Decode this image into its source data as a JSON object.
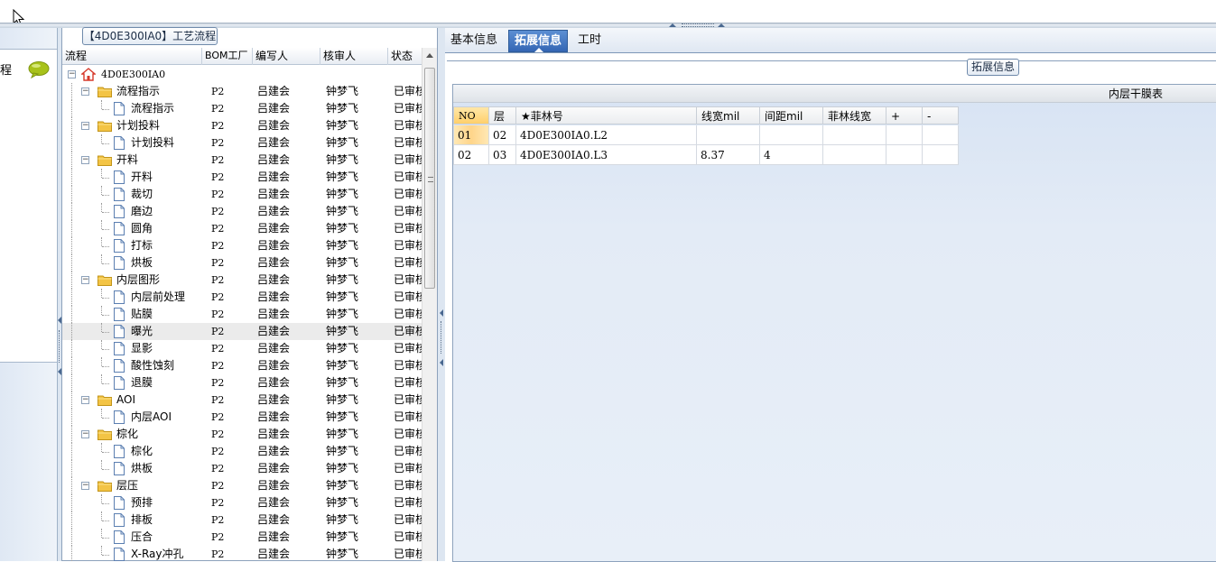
{
  "colors": {
    "accent": "#3466b4",
    "folder": "#f3c445",
    "home": "#d63a2c",
    "row_highlight": "#ffd58a"
  },
  "left_panel": {
    "partial_label": "程",
    "icon": "chat-bubble-icon"
  },
  "tree": {
    "group_title": "【4D0E300IA0】工艺流程",
    "columns": [
      "流程",
      "BOM工厂",
      "编写人",
      "核审人",
      "状态"
    ],
    "rows": [
      {
        "name": "4D0E300IA0",
        "level": 0,
        "type": "root",
        "bom": "",
        "writer": "",
        "reviewer": "",
        "status": ""
      },
      {
        "name": "流程指示",
        "level": 1,
        "type": "folder",
        "bom": "P2",
        "writer": "吕建会",
        "reviewer": "钟梦飞",
        "status": "已审核"
      },
      {
        "name": "流程指示",
        "level": 2,
        "type": "file",
        "bom": "P2",
        "writer": "吕建会",
        "reviewer": "钟梦飞",
        "status": "已审核"
      },
      {
        "name": "计划投料",
        "level": 1,
        "type": "folder",
        "bom": "P2",
        "writer": "吕建会",
        "reviewer": "钟梦飞",
        "status": "已审核"
      },
      {
        "name": "计划投料",
        "level": 2,
        "type": "file",
        "bom": "P2",
        "writer": "吕建会",
        "reviewer": "钟梦飞",
        "status": "已审核"
      },
      {
        "name": "开料",
        "level": 1,
        "type": "folder",
        "bom": "P2",
        "writer": "吕建会",
        "reviewer": "钟梦飞",
        "status": "已审核"
      },
      {
        "name": "开料",
        "level": 2,
        "type": "file",
        "bom": "P2",
        "writer": "吕建会",
        "reviewer": "钟梦飞",
        "status": "已审核"
      },
      {
        "name": "裁切",
        "level": 2,
        "type": "file",
        "bom": "P2",
        "writer": "吕建会",
        "reviewer": "钟梦飞",
        "status": "已审核"
      },
      {
        "name": "磨边",
        "level": 2,
        "type": "file",
        "bom": "P2",
        "writer": "吕建会",
        "reviewer": "钟梦飞",
        "status": "已审核"
      },
      {
        "name": "圆角",
        "level": 2,
        "type": "file",
        "bom": "P2",
        "writer": "吕建会",
        "reviewer": "钟梦飞",
        "status": "已审核"
      },
      {
        "name": "打标",
        "level": 2,
        "type": "file",
        "bom": "P2",
        "writer": "吕建会",
        "reviewer": "钟梦飞",
        "status": "已审核"
      },
      {
        "name": "烘板",
        "level": 2,
        "type": "file",
        "bom": "P2",
        "writer": "吕建会",
        "reviewer": "钟梦飞",
        "status": "已审核"
      },
      {
        "name": "内层图形",
        "level": 1,
        "type": "folder",
        "bom": "P2",
        "writer": "吕建会",
        "reviewer": "钟梦飞",
        "status": "已审核"
      },
      {
        "name": "内层前处理",
        "level": 2,
        "type": "file",
        "bom": "P2",
        "writer": "吕建会",
        "reviewer": "钟梦飞",
        "status": "已审核"
      },
      {
        "name": "贴膜",
        "level": 2,
        "type": "file",
        "bom": "P2",
        "writer": "吕建会",
        "reviewer": "钟梦飞",
        "status": "已审核"
      },
      {
        "name": "曝光",
        "level": 2,
        "type": "file",
        "bom": "P2",
        "writer": "吕建会",
        "reviewer": "钟梦飞",
        "status": "已审核",
        "selected": true
      },
      {
        "name": "显影",
        "level": 2,
        "type": "file",
        "bom": "P2",
        "writer": "吕建会",
        "reviewer": "钟梦飞",
        "status": "已审核"
      },
      {
        "name": "酸性蚀刻",
        "level": 2,
        "type": "file",
        "bom": "P2",
        "writer": "吕建会",
        "reviewer": "钟梦飞",
        "status": "已审核"
      },
      {
        "name": "退膜",
        "level": 2,
        "type": "file",
        "bom": "P2",
        "writer": "吕建会",
        "reviewer": "钟梦飞",
        "status": "已审核"
      },
      {
        "name": "AOI",
        "level": 1,
        "type": "folder",
        "bom": "P2",
        "writer": "吕建会",
        "reviewer": "钟梦飞",
        "status": "已审核"
      },
      {
        "name": "内层AOI",
        "level": 2,
        "type": "file",
        "bom": "P2",
        "writer": "吕建会",
        "reviewer": "钟梦飞",
        "status": "已审核"
      },
      {
        "name": "棕化",
        "level": 1,
        "type": "folder",
        "bom": "P2",
        "writer": "吕建会",
        "reviewer": "钟梦飞",
        "status": "已审核"
      },
      {
        "name": "棕化",
        "level": 2,
        "type": "file",
        "bom": "P2",
        "writer": "吕建会",
        "reviewer": "钟梦飞",
        "status": "已审核"
      },
      {
        "name": "烘板",
        "level": 2,
        "type": "file",
        "bom": "P2",
        "writer": "吕建会",
        "reviewer": "钟梦飞",
        "status": "已审核"
      },
      {
        "name": "层压",
        "level": 1,
        "type": "folder",
        "bom": "P2",
        "writer": "吕建会",
        "reviewer": "钟梦飞",
        "status": "已审核"
      },
      {
        "name": "预排",
        "level": 2,
        "type": "file",
        "bom": "P2",
        "writer": "吕建会",
        "reviewer": "钟梦飞",
        "status": "已审核"
      },
      {
        "name": "排板",
        "level": 2,
        "type": "file",
        "bom": "P2",
        "writer": "吕建会",
        "reviewer": "钟梦飞",
        "status": "已审核"
      },
      {
        "name": "压合",
        "level": 2,
        "type": "file",
        "bom": "P2",
        "writer": "吕建会",
        "reviewer": "钟梦飞",
        "status": "已审核"
      },
      {
        "name": "X-Ray冲孔",
        "level": 2,
        "type": "file",
        "bom": "P2",
        "writer": "吕建会",
        "reviewer": "钟梦飞",
        "status": "已审核"
      }
    ]
  },
  "right": {
    "tabs": [
      {
        "label": "基本信息",
        "active": false
      },
      {
        "label": "拓展信息",
        "active": true
      },
      {
        "label": "工时",
        "active": false
      }
    ],
    "group_title": "拓展信息",
    "grid_title": "内层干膜表",
    "columns": [
      "NO",
      "层",
      "★菲林号",
      "线宽mil",
      "间距mil",
      "菲林线宽",
      "+",
      "-"
    ],
    "rows": [
      [
        "01",
        "02",
        "4D0E300IA0.L2",
        "",
        "",
        "",
        "",
        ""
      ],
      [
        "02",
        "03",
        "4D0E300IA0.L3",
        "8.37",
        "4",
        "",
        "",
        ""
      ]
    ]
  }
}
